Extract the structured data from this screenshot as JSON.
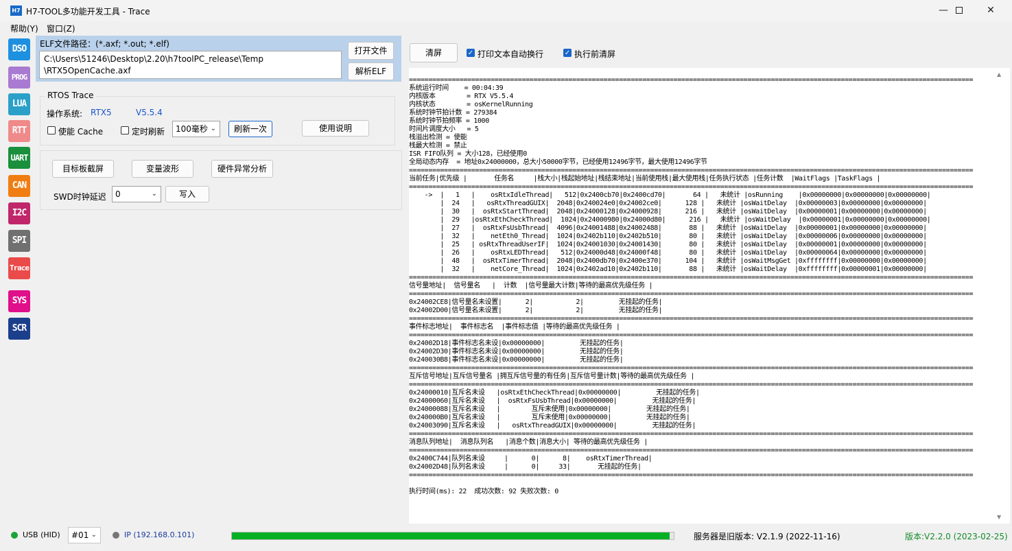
{
  "window": {
    "app_icon": "H7",
    "title": "H7-TOOL多功能开发工具 - Trace",
    "min_icon": "minimize-icon",
    "max_icon": "maximize-icon",
    "close_icon": "close-icon"
  },
  "menu": [
    "帮助(Y)",
    "窗口(Z)"
  ],
  "sidebar": [
    {
      "label": "DSO",
      "color": "#1e90e0"
    },
    {
      "label": "PROG",
      "color": "#a97ad1"
    },
    {
      "label": "LUA",
      "color": "#2aa0c8"
    },
    {
      "label": "RTT",
      "color": "#f08a8a"
    },
    {
      "label": "UART",
      "color": "#1a8f3c"
    },
    {
      "label": "CAN",
      "color": "#f07d12"
    },
    {
      "label": "I2C",
      "color": "#c0266a"
    },
    {
      "label": "SPI",
      "color": "#707070"
    },
    {
      "label": "Trace",
      "color": "#ea4a4a"
    },
    {
      "label": "SYS",
      "color": "#e0108a"
    },
    {
      "label": "SCR",
      "color": "#1c3f8c"
    }
  ],
  "elf": {
    "label": "ELF文件路径：(*.axf; *.out; *.elf)",
    "path_line1": "C:\\Users\\51246\\Desktop\\2.20\\h7toolPC_release\\Temp",
    "path_line2": "\\RTX5OpenCache.axf",
    "open_btn": "打开文件",
    "parse_btn": "解析ELF"
  },
  "rtos": {
    "group_title": "RTOS Trace",
    "os_label": "操作系统:",
    "os_name": "RTX5",
    "os_version": "V5.5.4",
    "cache_label": "使能 Cache",
    "cache_checked": false,
    "timer_label": "定时刷新",
    "timer_checked": false,
    "interval": "100毫秒",
    "refresh_btn": "刷新一次",
    "help_btn": "使用说明"
  },
  "tools": {
    "screenshot_btn": "目标板截屏",
    "wave_btn": "变量波形",
    "fault_btn": "硬件异常分析",
    "swd_label": "SWD时钟延迟",
    "swd_value": "0",
    "write_btn": "写入"
  },
  "output_toolbar": {
    "clear_btn": "清屏",
    "autowrap_label": "打印文本自动换行",
    "autowrap_checked": true,
    "clear_before_label": "执行前清屏",
    "clear_before_checked": true
  },
  "output_text": "\n=================================================================================================================================================\n系统运行时间    = 00:04:39\n内核版本        = RTX V5.5.4\n内核状态        = osKernelRunning\n系统时钟节拍计数 = 279384\n系统时钟节拍频率 = 1000\n时间片调度大小   = 5\n栈溢出检测 = 使能\n栈最大检测 = 禁止\nISR FIFO队列 = 大小128，已经使用0\n全局动态内存  = 地址0x24000000，总大小50000字节，已经使用12496字节，最大使用12496字节\n=================================================================================================================================================\n当前任务|优先级 |       任务名     |栈大小|栈起始地址|栈结束地址|当前使用栈|最大使用栈|任务执行状态 |任务计数  |WaitFlags |TaskFlags |\n=================================================================================================================================================\n    ->  |   1   |    osRtxIdleThread|   512|0x2400cb70|0x2400cd70|       64 |   未统计 |osRunning    |0x00000000|0x00000000|0x00000000|\n        |  24   |   osRtxThreadGUIX|  2048|0x240024e0|0x24002ce0|      128 |   未统计 |osWaitDelay  |0x00000003|0x00000000|0x00000000|\n        |  30   |  osRtxStartThread|  2048|0x24000128|0x24000928|      216 |   未统计 |osWaitDelay  |0x00000001|0x00000000|0x00000000|\n        |  29   |osRtxEthCheckThread|  1024|0x24000980|0x24000d80|      216 |   未统计 |osWaitDelay  |0x00000001|0x00000000|0x00000000|\n        |  27   |  osRtxFsUsbThread|  4096|0x24001488|0x24002488|       88 |   未统计 |osWaitDelay  |0x00000001|0x00000000|0x00000000|\n        |  32   |    netEth0_Thread|  1024|0x2402b110|0x2402b510|       80 |   未统计 |osWaitDelay  |0x00000006|0x00000000|0x00000000|\n        |  25   | osRtxThreadUserIF|  1024|0x24001030|0x24001430|       80 |   未统计 |osWaitDelay  |0x00000001|0x00000000|0x00000000|\n        |  26   |    osRtxLEDThread|   512|0x24000d48|0x24000f48|       80 |   未统计 |osWaitDelay  |0x00000064|0x00000000|0x00000000|\n        |  48   |  osRtxTimerThread|  2048|0x2400db70|0x2400e370|      104 |   未统计 |osWaitMsgGet |0xffffffff|0x00000000|0x00000000|\n        |  32   |    netCore_Thread|  1024|0x2402ad10|0x2402b110|       88 |   未统计 |osWaitDelay  |0xffffffff|0x00000001|0x00000000|\n=================================================================================================================================================\n信号量地址|  信号量名   |  计数  |信号量最大计数|等待的最高优先级任务 |\n=================================================================================================================================================\n0x24002CE8|信号量名未设置|      2|           2|         无挂起的任务|\n0x24002D00|信号量名未设置|      2|           2|         无挂起的任务|\n=================================================================================================================================================\n事件标志地址|  事件标志名  |事件标志值 |等待的最高优先级任务 |\n=================================================================================================================================================\n0x24002D18|事件标志名未设|0x00000000|         无挂起的任务|\n0x24002D30|事件标志名未设|0x00000000|         无挂起的任务|\n0x240030B8|事件标志名未设|0x00000000|         无挂起的任务|\n=================================================================================================================================================\n互斥信号地址|互斥信号量名 |拥互斥信号量的有任务|互斥信号量计数|等待的最高优先级任务 |\n=================================================================================================================================================\n0x24000010|互斥名未设   |osRtxEthCheckThread|0x00000000|         无挂起的任务|\n0x24000060|互斥名未设   |  osRtxFsUsbThread|0x00000000|         无挂起的任务|\n0x24000088|互斥名未设   |        互斥未使用|0x00000000|         无挂起的任务|\n0x240000B0|互斥名未设   |        互斥未使用|0x00000000|         无挂起的任务|\n0x24003090|互斥名未设   |   osRtxThreadGUIX|0x00000000|         无挂起的任务|\n=================================================================================================================================================\n消息队列地址|  消息队列名   |消息个数|消息大小| 等待的最高优先级任务 |\n=================================================================================================================================================\n0x2400C744|队列名未设     |      0|      8|    osRtxTimerThread|\n0x24002D48|队列名未设     |      0|     33|       无挂起的任务|\n=================================================================================================================================================\n\n执行时间(ms): 22  成功次数: 92 失败次数: 0",
  "status": {
    "usb_label": "USB (HID)",
    "usb_color": "#1aa33a",
    "device": "#01",
    "ip_label": "IP (192.168.0.101)",
    "progress": 0.99,
    "server_version": "服务器是旧版本: V2.1.9 (2022-11-16)",
    "version": "版本:V2.2.0 (2023-02-25)"
  }
}
